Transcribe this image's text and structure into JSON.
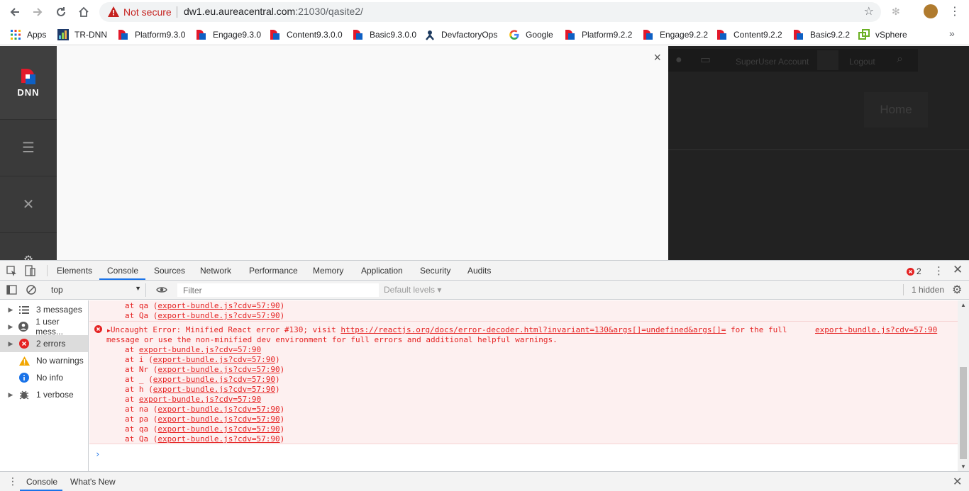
{
  "browser": {
    "not_secure": "Not secure",
    "url_host": "dw1.eu.aureacentral.com",
    "url_rest": ":21030/qasite2/"
  },
  "bookmarks": [
    {
      "label": "Apps",
      "icon": "apps-grid-icon"
    },
    {
      "label": "TR-DNN",
      "icon": "trdnn-icon"
    },
    {
      "label": "Platform9.3.0",
      "icon": "dnn-icon"
    },
    {
      "label": "Engage9.3.0",
      "icon": "dnn-icon"
    },
    {
      "label": "Content9.3.0.0",
      "icon": "dnn-icon"
    },
    {
      "label": "Basic9.3.0.0",
      "icon": "dnn-icon"
    },
    {
      "label": "DevfactoryOps",
      "icon": "devfactory-icon"
    },
    {
      "label": "Google",
      "icon": "google-icon"
    },
    {
      "label": "Platform9.2.2",
      "icon": "dnn-icon"
    },
    {
      "label": "Engage9.2.2",
      "icon": "dnn-icon"
    },
    {
      "label": "Content9.2.2",
      "icon": "dnn-icon"
    },
    {
      "label": "Basic9.2.2",
      "icon": "dnn-icon"
    },
    {
      "label": "vSphere",
      "icon": "vsphere-icon"
    }
  ],
  "site": {
    "logo_text": "DNN",
    "user": "SuperUser Account",
    "logout": "Logout",
    "home": "Home"
  },
  "devtools": {
    "tabs": [
      "Elements",
      "Console",
      "Sources",
      "Network",
      "Performance",
      "Memory",
      "Application",
      "Security",
      "Audits"
    ],
    "active_tab": "Console",
    "error_count": "2",
    "context": "top",
    "filter_placeholder": "Filter",
    "levels": "Default levels",
    "hidden": "1 hidden",
    "sidebar": [
      {
        "label": "3 messages",
        "icon": "list-icon"
      },
      {
        "label": "1 user mess...",
        "icon": "user-icon"
      },
      {
        "label": "2 errors",
        "icon": "error-icon"
      },
      {
        "label": "No warnings",
        "icon": "warning-icon"
      },
      {
        "label": "No info",
        "icon": "info-icon"
      },
      {
        "label": "1 verbose",
        "icon": "bug-icon"
      }
    ],
    "prev_lines": [
      {
        "fn": "at qa",
        "src": "export-bundle.js?cdv=57:90"
      },
      {
        "fn": "at Qa",
        "src": "export-bundle.js?cdv=57:90"
      }
    ],
    "error": {
      "line1_prefix": "Uncaught Error: Minified React error #130; visit ",
      "line1_link": "https://reactjs.org/docs/error-decoder.html?invariant=130&args[]=undefined&args[]=",
      "line1_suffix": " for the full",
      "line2": "message or use the non-minified dev environment for full errors and additional helpful warnings.",
      "source": "export-bundle.js?cdv=57:90",
      "stack": [
        {
          "fn": "at ",
          "src": "export-bundle.js?cdv=57:90",
          "paren": false
        },
        {
          "fn": "at i ",
          "src": "export-bundle.js?cdv=57:90",
          "paren": true
        },
        {
          "fn": "at Nr ",
          "src": "export-bundle.js?cdv=57:90",
          "paren": true
        },
        {
          "fn": "at _ ",
          "src": "export-bundle.js?cdv=57:90",
          "paren": true
        },
        {
          "fn": "at h ",
          "src": "export-bundle.js?cdv=57:90",
          "paren": true
        },
        {
          "fn": "at ",
          "src": "export-bundle.js?cdv=57:90",
          "paren": false
        },
        {
          "fn": "at na ",
          "src": "export-bundle.js?cdv=57:90",
          "paren": true
        },
        {
          "fn": "at pa ",
          "src": "export-bundle.js?cdv=57:90",
          "paren": true
        },
        {
          "fn": "at qa ",
          "src": "export-bundle.js?cdv=57:90",
          "paren": true
        },
        {
          "fn": "at Qa ",
          "src": "export-bundle.js?cdv=57:90",
          "paren": true
        }
      ]
    },
    "drawer_tabs": [
      "Console",
      "What's New"
    ]
  }
}
